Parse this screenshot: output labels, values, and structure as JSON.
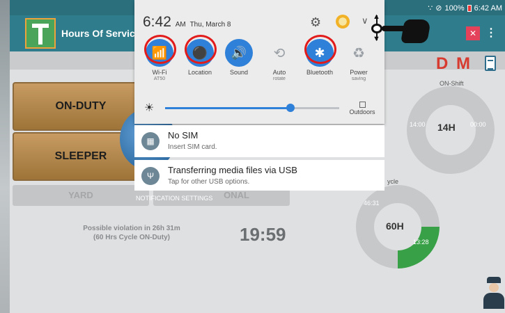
{
  "app": {
    "title": "Hours Of Service",
    "statusbar": {
      "battery": "100%",
      "time": "6:42 AM",
      "left_indicator": "B"
    },
    "duty_letters": {
      "d": "D",
      "m": "M"
    },
    "buttons": {
      "on_duty": "ON-DUTY",
      "sleeper": "SLEEPER",
      "yard": "YARD",
      "personal": "ONAL"
    },
    "violation": {
      "line1": "Possible violation in 26h 31m",
      "line2": "(60 Hrs Cycle ON-Duty)"
    },
    "countdown": "19:59",
    "on_shift": {
      "label": "ON-Shift",
      "left": "14:00",
      "center": "14H",
      "right": "00:00"
    },
    "cycle": {
      "label": "ycle",
      "left": "46:31",
      "center": "60H",
      "right": "13:28",
      "progress_fraction": 0.25,
      "progress_color": "#38a046"
    }
  },
  "shade": {
    "time": "6:42",
    "ampm": "AM",
    "date": "Thu, March 8",
    "tiles": [
      {
        "label": "Wi-Fi",
        "sub": "AT50",
        "icon": "wifi-icon",
        "glyph": "📶",
        "on": true
      },
      {
        "label": "Location",
        "sub": "",
        "icon": "location-pin-icon",
        "glyph": "⚫",
        "on": true
      },
      {
        "label": "Sound",
        "sub": "",
        "icon": "sound-icon",
        "glyph": "🔊",
        "on": true
      },
      {
        "label": "Auto",
        "sub": "rotate",
        "icon": "auto-rotate-icon",
        "glyph": "⟲",
        "on": false
      },
      {
        "label": "Bluetooth",
        "sub": "",
        "icon": "bluetooth-icon",
        "glyph": "✱",
        "on": true
      },
      {
        "label": "Power",
        "sub": "saving",
        "icon": "power-saving-icon",
        "glyph": "♻",
        "on": false
      }
    ],
    "brightness": 0.72,
    "outdoors_label": "Outdoors",
    "notifications": [
      {
        "title": "No SIM",
        "subtitle": "Insert SIM card.",
        "icon": "sim-icon"
      },
      {
        "title": "Transferring media files via USB",
        "subtitle": "Tap for other USB options.",
        "icon": "usb-icon"
      }
    ],
    "settings_label": "NOTIFICATION SETTINGS"
  },
  "colors": {
    "accent": "#2f80d8",
    "highlight_ring": "#e21b1b",
    "titlebar": "#2f7d8c"
  }
}
